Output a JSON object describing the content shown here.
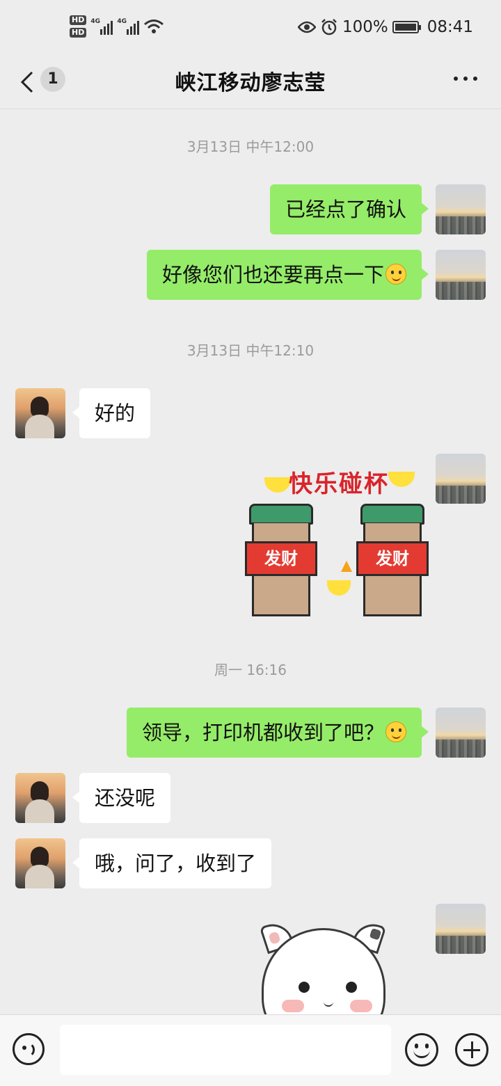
{
  "status_bar": {
    "hd1": "HD",
    "hd2": "HD",
    "net1": "4G",
    "net2": "4G",
    "battery": "100%",
    "time": "08:41",
    "icons": [
      "eye-icon",
      "alarm-icon",
      "battery-icon",
      "wifi-icon",
      "signal-icon"
    ]
  },
  "header": {
    "unread_count": "1",
    "title": "峡江移动廖志莹",
    "icons": [
      "back-arrow-icon",
      "more-dots-icon"
    ]
  },
  "messages": {
    "ts1": "3月13日 中午12:00",
    "m1": "已经点了确认",
    "m2": "好像您们也还要再点一下",
    "ts2": "3月13日 中午12:10",
    "m3": "好的",
    "sticker1_caption": "快乐碰杯",
    "sticker1_band": "发财",
    "ts3": "周一 16:16",
    "m5": "领导，打印机都收到了吧？",
    "m6": "还没呢",
    "m7": "哦，问了，收到了"
  },
  "input_bar": {
    "text": "",
    "icons": [
      "voice-icon",
      "emoji-icon",
      "plus-icon"
    ]
  },
  "colors": {
    "background": "#ededed",
    "my_bubble": "#95ec69",
    "their_bubble": "#ffffff"
  }
}
